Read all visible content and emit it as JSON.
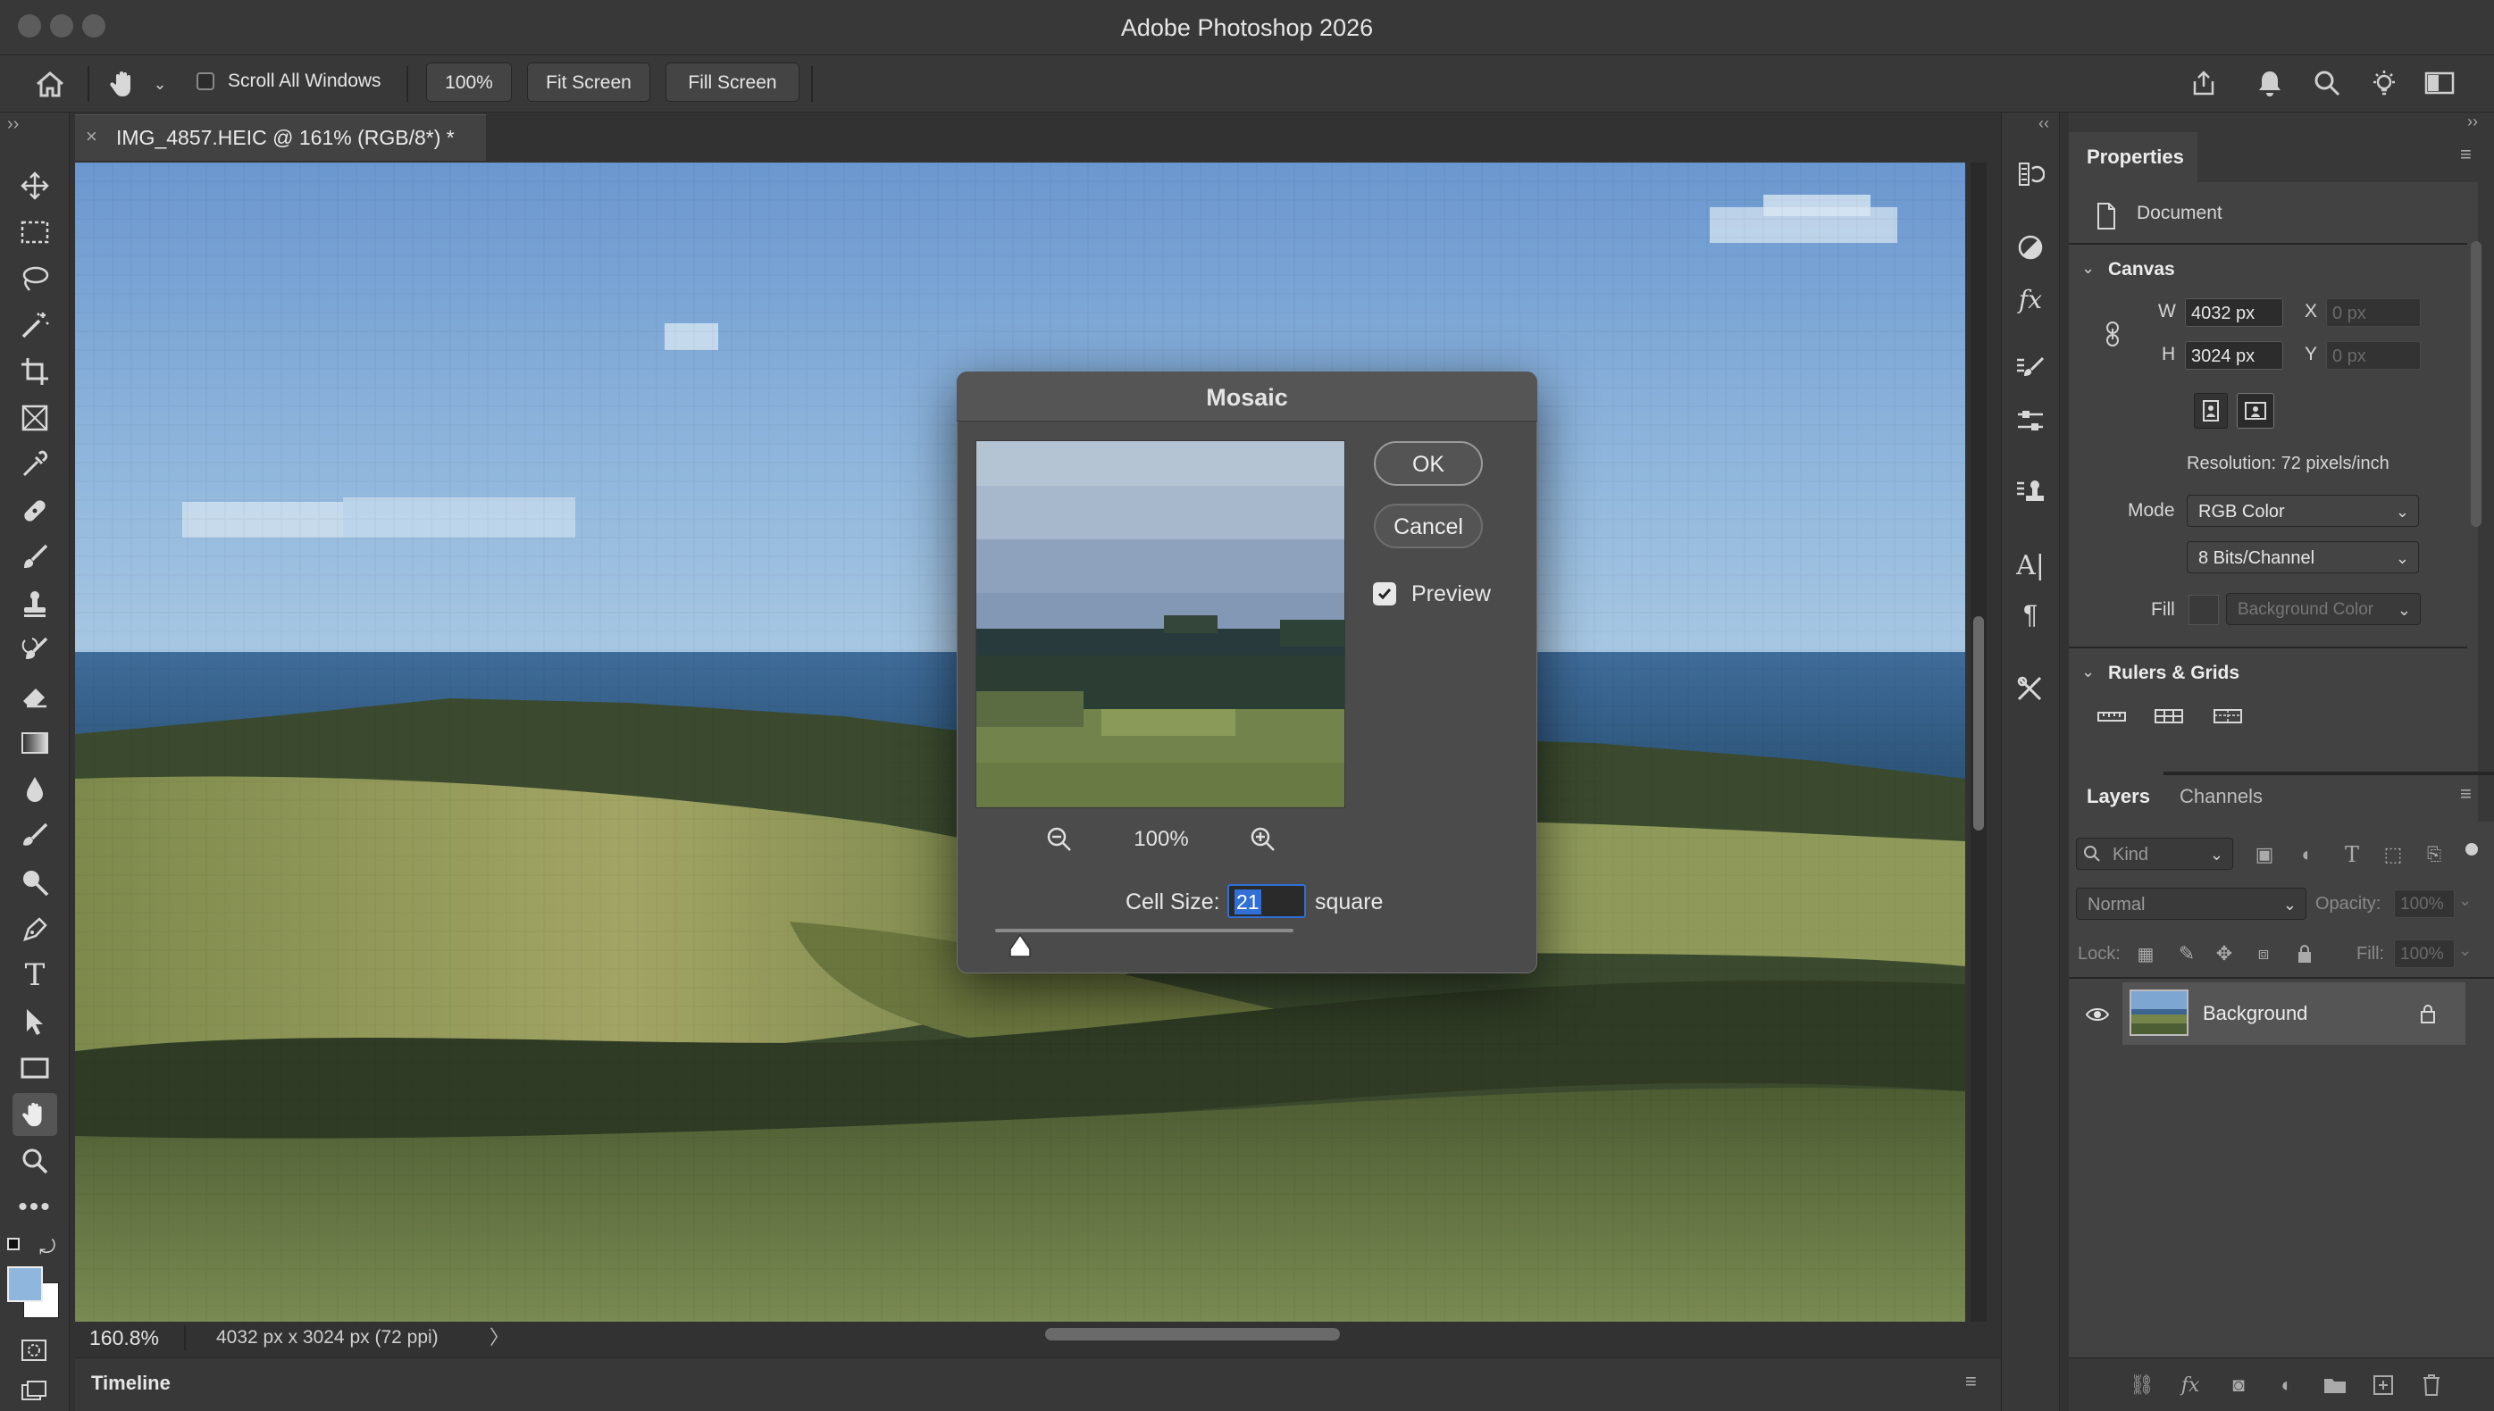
{
  "window": {
    "title": "Adobe Photoshop 2026"
  },
  "options_bar": {
    "scroll_all_windows_label": "Scroll All Windows",
    "scroll_all_windows_checked": false,
    "zoom_button": "100%",
    "fit_screen_button": "Fit Screen",
    "fill_screen_button": "Fill Screen"
  },
  "tools": [
    "move-tool",
    "marquee-tool",
    "lasso-tool",
    "magic-wand-tool",
    "crop-tool",
    "frame-tool",
    "eyedropper-tool",
    "healing-brush-tool",
    "brush-tool",
    "clone-stamp-tool",
    "history-brush-tool",
    "eraser-tool",
    "gradient-tool",
    "blur-tool",
    "dodge-tool",
    "sponge-tool",
    "pen-tool",
    "type-tool",
    "path-selection-tool",
    "rectangle-tool",
    "hand-tool",
    "zoom-tool",
    "more-tools"
  ],
  "document": {
    "tab_title": "IMG_4857.HEIC @ 161% (RGB/8*) *",
    "zoom_readout": "160.8%",
    "doc_info": "4032 px x 3024 px (72 ppi)"
  },
  "timeline": {
    "label": "Timeline"
  },
  "properties": {
    "tab": "Properties",
    "section_document": "Document",
    "canvas_heading": "Canvas",
    "w_label": "W",
    "w_value": "4032 px",
    "h_label": "H",
    "h_value": "3024 px",
    "x_label": "X",
    "x_value": "0 px",
    "y_label": "Y",
    "y_value": "0 px",
    "resolution": "Resolution: 72 pixels/inch",
    "mode_label": "Mode",
    "mode_value": "RGB Color",
    "depth_value": "8 Bits/Channel",
    "fill_label": "Fill",
    "fill_value": "Background Color",
    "rulers_heading": "Rulers & Grids"
  },
  "layers_panel": {
    "tabs": [
      "Layers",
      "Channels"
    ],
    "active_tab": "Layers",
    "kind_placeholder": "Kind",
    "blend_mode": "Normal",
    "opacity_label": "Opacity:",
    "opacity_value": "100%",
    "lock_label": "Lock:",
    "fill_label": "Fill:",
    "fill_value": "100%",
    "layers": [
      {
        "name": "Background",
        "visible": true,
        "locked": true
      }
    ]
  },
  "mosaic_dialog": {
    "title": "Mosaic",
    "ok_label": "OK",
    "cancel_label": "Cancel",
    "preview_label": "Preview",
    "preview_checked": true,
    "zoom_value": "100%",
    "cell_size_label": "Cell Size:",
    "cell_size_value": "21",
    "cell_size_unit": "square",
    "slider_fraction": 0.09
  },
  "colors": {
    "accent_blue": "#2f6fd6",
    "foreground_swatch": "#8fb7dd",
    "background_swatch": "#ffffff"
  }
}
